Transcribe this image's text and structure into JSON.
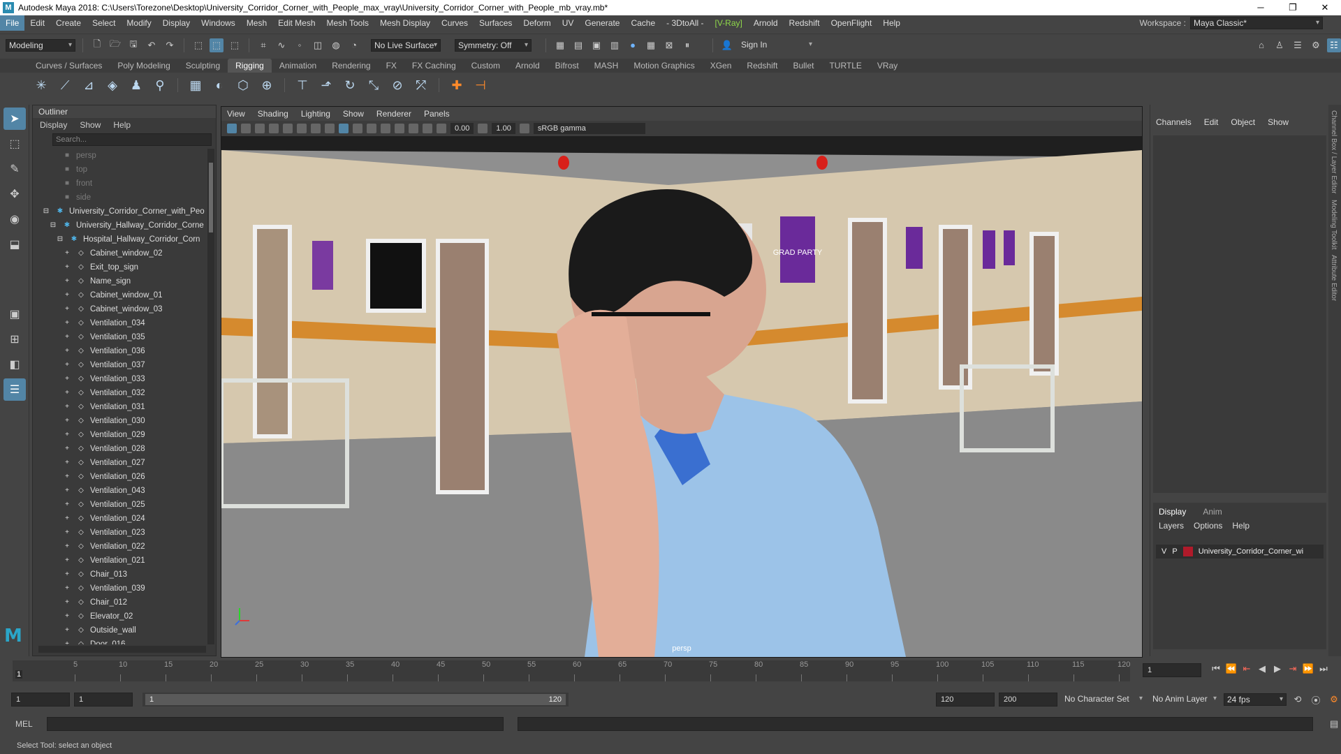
{
  "window": {
    "title": "Autodesk Maya 2018: C:\\Users\\Torezone\\Desktop\\University_Corridor_Corner_with_People_max_vray\\University_Corridor_Corner_with_People_mb_vray.mb*",
    "logo_letter": "M",
    "minimize": "─",
    "maximize": "❐",
    "close": "✕"
  },
  "menubar": {
    "items": [
      "File",
      "Edit",
      "Create",
      "Select",
      "Modify",
      "Display",
      "Windows",
      "Mesh",
      "Edit Mesh",
      "Mesh Tools",
      "Mesh Display",
      "Curves",
      "Surfaces",
      "Deform",
      "UV",
      "Generate",
      "Cache",
      "- 3DtoAll -",
      "[V-Ray]",
      "Arnold",
      "Redshift",
      "OpenFlight",
      "Help"
    ],
    "workspace_label": "Workspace :",
    "workspace_value": "Maya Classic*"
  },
  "statusline": {
    "mode": "Modeling",
    "live_surface": "No Live Surface",
    "symmetry": "Symmetry: Off",
    "sign_in": "Sign In"
  },
  "shelf": {
    "tabs": [
      "Curves / Surfaces",
      "Poly Modeling",
      "Sculpting",
      "Rigging",
      "Animation",
      "Rendering",
      "FX",
      "FX Caching",
      "Custom",
      "Arnold",
      "Bifrost",
      "MASH",
      "Motion Graphics",
      "XGen",
      "Redshift",
      "Bullet",
      "TURTLE",
      "VRay"
    ],
    "active_tab": "Rigging"
  },
  "outliner": {
    "title": "Outliner",
    "menu": [
      "Display",
      "Show",
      "Help"
    ],
    "search_placeholder": "Search...",
    "rows": [
      {
        "label": "persp",
        "type": "camera",
        "indent": 1
      },
      {
        "label": "top",
        "type": "camera",
        "indent": 1
      },
      {
        "label": "front",
        "type": "camera",
        "indent": 1
      },
      {
        "label": "side",
        "type": "camera",
        "indent": 1
      },
      {
        "label": "University_Corridor_Corner_with_Peo",
        "type": "group",
        "indent": 0
      },
      {
        "label": "University_Hallway_Corridor_Corne",
        "type": "group",
        "indent": 1
      },
      {
        "label": "Hospital_Hallway_Corridor_Corn",
        "type": "group",
        "indent": 2
      },
      {
        "label": "Cabinet_window_02",
        "type": "mesh",
        "indent": 3
      },
      {
        "label": "Exit_top_sign",
        "type": "mesh",
        "indent": 3
      },
      {
        "label": "Name_sign",
        "type": "mesh",
        "indent": 3
      },
      {
        "label": "Cabinet_window_01",
        "type": "mesh",
        "indent": 3
      },
      {
        "label": "Cabinet_window_03",
        "type": "mesh",
        "indent": 3
      },
      {
        "label": "Ventilation_034",
        "type": "mesh",
        "indent": 3
      },
      {
        "label": "Ventilation_035",
        "type": "mesh",
        "indent": 3
      },
      {
        "label": "Ventilation_036",
        "type": "mesh",
        "indent": 3
      },
      {
        "label": "Ventilation_037",
        "type": "mesh",
        "indent": 3
      },
      {
        "label": "Ventilation_033",
        "type": "mesh",
        "indent": 3
      },
      {
        "label": "Ventilation_032",
        "type": "mesh",
        "indent": 3
      },
      {
        "label": "Ventilation_031",
        "type": "mesh",
        "indent": 3
      },
      {
        "label": "Ventilation_030",
        "type": "mesh",
        "indent": 3
      },
      {
        "label": "Ventilation_029",
        "type": "mesh",
        "indent": 3
      },
      {
        "label": "Ventilation_028",
        "type": "mesh",
        "indent": 3
      },
      {
        "label": "Ventilation_027",
        "type": "mesh",
        "indent": 3
      },
      {
        "label": "Ventilation_026",
        "type": "mesh",
        "indent": 3
      },
      {
        "label": "Ventilation_043",
        "type": "mesh",
        "indent": 3
      },
      {
        "label": "Ventilation_025",
        "type": "mesh",
        "indent": 3
      },
      {
        "label": "Ventilation_024",
        "type": "mesh",
        "indent": 3
      },
      {
        "label": "Ventilation_023",
        "type": "mesh",
        "indent": 3
      },
      {
        "label": "Ventilation_022",
        "type": "mesh",
        "indent": 3
      },
      {
        "label": "Ventilation_021",
        "type": "mesh",
        "indent": 3
      },
      {
        "label": "Chair_013",
        "type": "mesh",
        "indent": 3
      },
      {
        "label": "Ventilation_039",
        "type": "mesh",
        "indent": 3
      },
      {
        "label": "Chair_012",
        "type": "mesh",
        "indent": 3
      },
      {
        "label": "Elevator_02",
        "type": "mesh",
        "indent": 3
      },
      {
        "label": "Outside_wall",
        "type": "mesh",
        "indent": 3
      },
      {
        "label": "Door_016",
        "type": "mesh",
        "indent": 3
      }
    ]
  },
  "viewport": {
    "menu": [
      "View",
      "Shading",
      "Lighting",
      "Show",
      "Renderer",
      "Panels"
    ],
    "exposure": "0.00",
    "gamma": "1.00",
    "color_space": "sRGB gamma",
    "camera_label": "persp",
    "poster_text": "GRAD PARTY"
  },
  "channel_box": {
    "menu": [
      "Channels",
      "Edit",
      "Object",
      "Show"
    ]
  },
  "layer_editor": {
    "tabs": [
      "Display",
      "Anim"
    ],
    "menu": [
      "Layers",
      "Options",
      "Help"
    ],
    "layer": {
      "v": "V",
      "p": "P",
      "name": "University_Corridor_Corner_wi",
      "color": "#b01a2a"
    }
  },
  "side_tabs": [
    "Channel Box / Layer Editor",
    "Modeling Toolkit",
    "Attribute Editor"
  ],
  "timeline": {
    "ticks": [
      "5",
      "10",
      "15",
      "20",
      "25",
      "30",
      "35",
      "40",
      "45",
      "50",
      "55",
      "60",
      "65",
      "70",
      "75",
      "80",
      "85",
      "90",
      "95",
      "100",
      "105",
      "110",
      "115",
      "120"
    ],
    "current_frame_marker": "1",
    "current_frame": "1"
  },
  "range": {
    "start": "1",
    "anim_start": "1",
    "slider_start": "1",
    "slider_end": "120",
    "anim_end": "120",
    "end": "200",
    "character_set": "No Character Set",
    "anim_layer": "No Anim Layer",
    "fps": "24 fps"
  },
  "cmdline": {
    "label": "MEL"
  },
  "helpline": {
    "text": "Select Tool: select an object"
  }
}
